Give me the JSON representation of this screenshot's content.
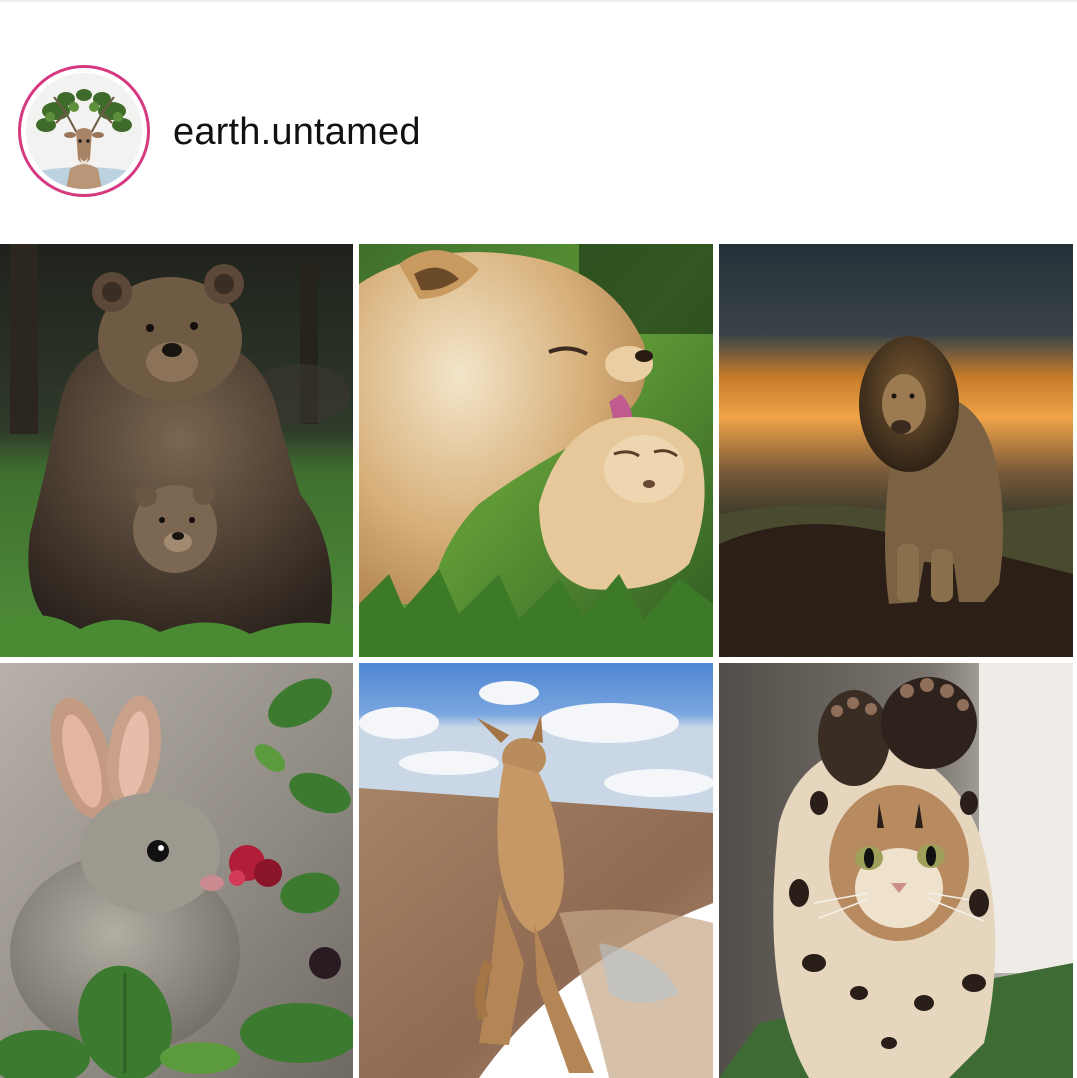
{
  "profile": {
    "username": "earth.untamed",
    "avatar_subject": "deer-with-leafy-antlers",
    "ring_color": "#d6397f"
  },
  "grid": {
    "posts": [
      {
        "subject": "brown-bear-with-cub",
        "palette": [
          "#2b2a22",
          "#4e8a3a",
          "#5b4a3c"
        ]
      },
      {
        "subject": "lioness-licking-cub",
        "palette": [
          "#d8b27a",
          "#6aa83e",
          "#efe0c2"
        ]
      },
      {
        "subject": "lion-at-sunset",
        "palette": [
          "#2f3c44",
          "#e89a3a",
          "#2a211b"
        ]
      },
      {
        "subject": "rabbit-eating-berry",
        "palette": [
          "#a29e98",
          "#3f7a33",
          "#b01e3a"
        ]
      },
      {
        "subject": "kangaroo-on-beach",
        "palette": [
          "#5c90d6",
          "#f5f7fb",
          "#b08a6a"
        ]
      },
      {
        "subject": "bengal-kitten-paws-up",
        "palette": [
          "#6b6660",
          "#e8dcc8",
          "#3a2a1f"
        ]
      }
    ]
  }
}
